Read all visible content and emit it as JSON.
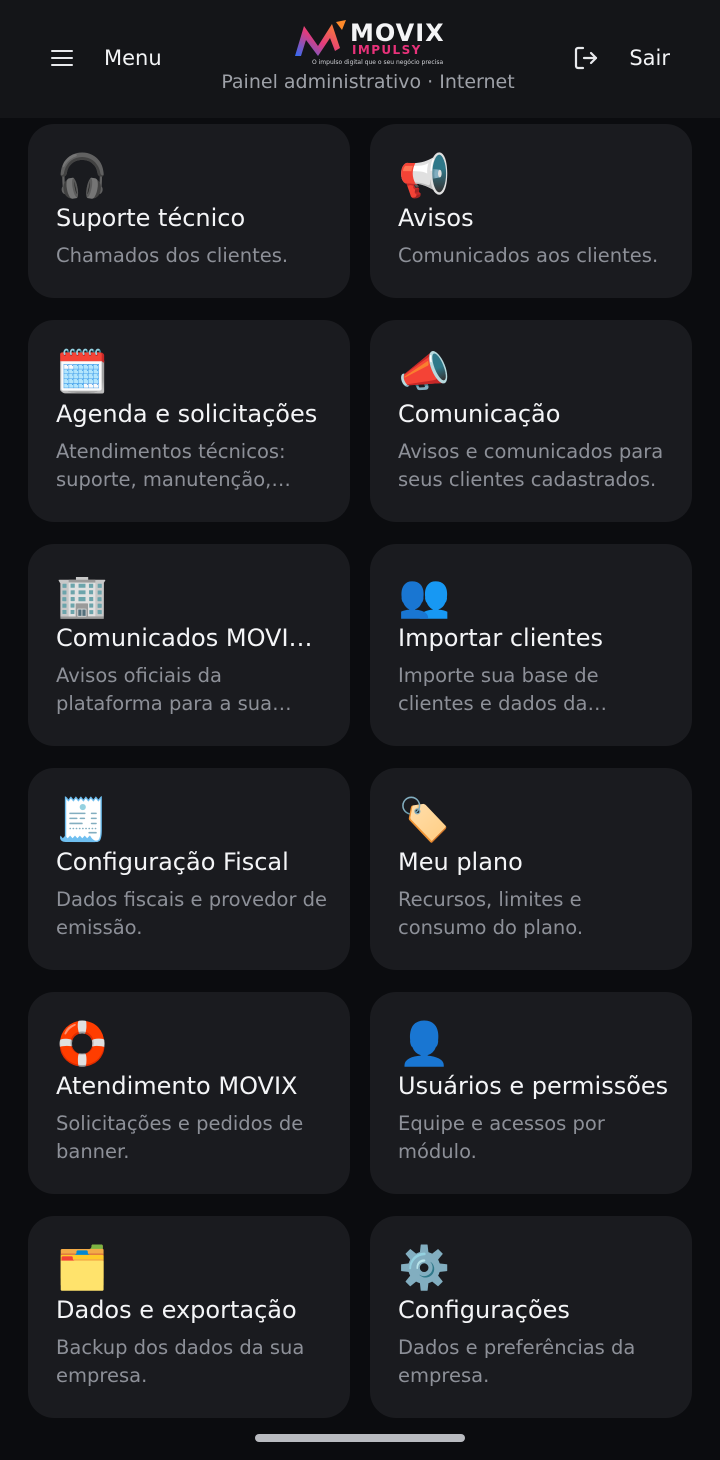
{
  "header": {
    "menu_label": "Menu",
    "logout_label": "Sair",
    "subtitle": "Painel administrativo · Internet",
    "logo": {
      "name": "MOVIX",
      "sub": "IMPULSY",
      "tagline": "O impulso digital que o seu negócio precisa"
    }
  },
  "cards": [
    {
      "icon": "headphones-icon",
      "emoji": "🎧",
      "title": "Suporte técnico",
      "desc": "Chamados dos clientes."
    },
    {
      "icon": "loudspeaker-icon",
      "emoji": "📢",
      "title": "Avisos",
      "desc": "Comunicados aos clientes."
    },
    {
      "icon": "calendar-icon",
      "emoji": "🗓️",
      "title": "Agenda e solicitações",
      "desc": "Atendimentos técnicos: suporte, manutenção, instalação e outros."
    },
    {
      "icon": "megaphone-icon",
      "emoji": "📣",
      "title": "Comunicação",
      "desc": "Avisos e comunicados para seus clientes cadastrados."
    },
    {
      "icon": "office-building-icon",
      "emoji": "🏢",
      "title": "Comunicados MOVIX Impulsy",
      "desc": "Avisos oficiais da plataforma para a sua empresa."
    },
    {
      "icon": "users-icon",
      "emoji": "👥",
      "title": "Importar clientes",
      "desc": "Importe sua base de clientes e dados da planilha."
    },
    {
      "icon": "receipt-icon",
      "emoji": "🧾",
      "title": "Configuração Fiscal",
      "desc": "Dados fiscais e provedor de emissão."
    },
    {
      "icon": "price-tag-icon",
      "emoji": "🏷️",
      "title": "Meu plano",
      "desc": "Recursos, limites e consumo do plano."
    },
    {
      "icon": "lifebuoy-icon",
      "emoji": "🛟",
      "title": "Atendimento MOVIX",
      "desc": "Solicitações e pedidos de banner."
    },
    {
      "icon": "user-icon",
      "emoji": "👤",
      "title": "Usuários e permissões",
      "desc": "Equipe e acessos por módulo."
    },
    {
      "icon": "folder-icon",
      "emoji": "🗂️",
      "title": "Dados e exportação",
      "desc": "Backup dos dados da sua empresa."
    },
    {
      "icon": "gear-icon",
      "emoji": "⚙️",
      "title": "Configurações",
      "desc": "Dados e preferências da empresa."
    }
  ]
}
